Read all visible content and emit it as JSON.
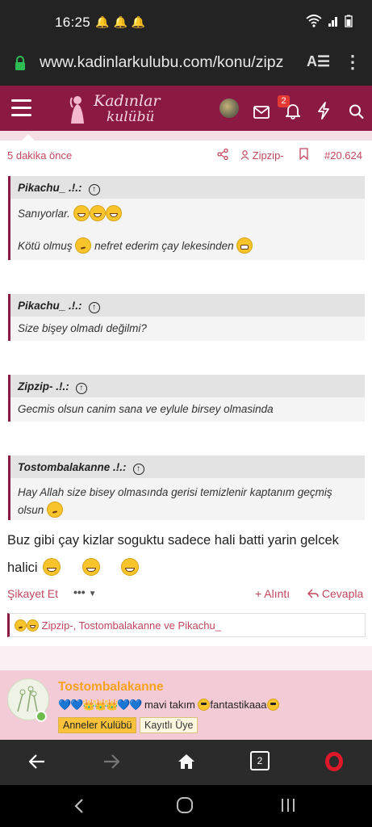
{
  "status_bar": {
    "time": "16:25",
    "notification_icons": [
      "bell-icon",
      "bell-icon",
      "bell-icon"
    ],
    "system_icons": [
      "wifi-icon",
      "signal-icon",
      "battery-icon"
    ]
  },
  "browser": {
    "url": "www.kadinlarkulubu.com/konu/zipz",
    "tab_count": "2"
  },
  "site_header": {
    "logo_line1": "Kadınlar",
    "logo_line2": "kulübü",
    "alert_count": "2",
    "accent_color": "#8a1a44"
  },
  "post_meta": {
    "time_ago": "5 dakika önce",
    "author": "Zipzip-",
    "post_number": "#20.624"
  },
  "quotes": [
    {
      "author": "Pikachu_ .!.:",
      "lines": [
        "Sanıyorlar.",
        "Kötü olmuş",
        "nefret ederim çay lekesinden"
      ]
    },
    {
      "author": "Pikachu_ .!.:",
      "lines": [
        "Size bişey olmadı değilmi?"
      ]
    },
    {
      "author": "Zipzip- .!.:",
      "lines": [
        "Gecmis olsun canim sana ve eylule birsey olmasinda"
      ]
    },
    {
      "author": "Tostombalakanne .!.:",
      "lines": [
        "Hay Allah size bisey olmasında gerisi temizlenir kaptanım geçmiş",
        "olsun"
      ]
    }
  ],
  "message": {
    "line1": "Buz gibi çay kizlar soguktu sadece hali batti yarin gelcek",
    "line2": "halici"
  },
  "actions": {
    "report": "Şikayet Et",
    "more": "•••",
    "quote": "+ Alıntı",
    "reply": "Cevapla"
  },
  "reactions": {
    "users": "Zipzip-, Tostombalakanne ve Pikachu_"
  },
  "next_post": {
    "author": "Tostombalakanne",
    "motto": "mavi takım",
    "motto_end": "fantastikaaa",
    "role": "Anneler Kulübü",
    "status": "Kayıtlı Üye"
  }
}
